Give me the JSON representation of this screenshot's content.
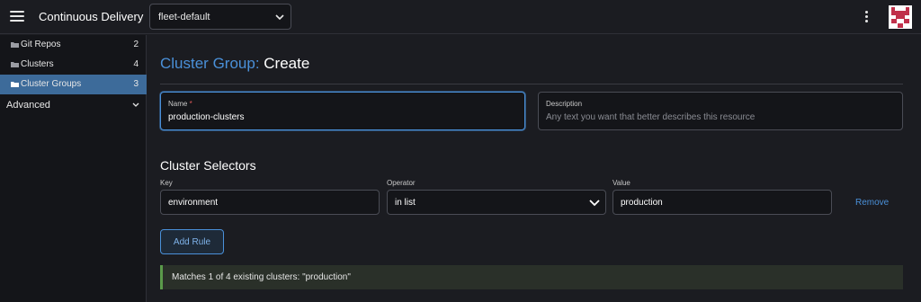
{
  "header": {
    "app_title": "Continuous Delivery",
    "workspace_value": "fleet-default",
    "menu_icon": "hamburger-menu-icon",
    "more_icon": "more-vertical-icon",
    "avatar_icon": "user-avatar"
  },
  "sidebar": {
    "items": [
      {
        "label": "Git Repos",
        "count": "2",
        "icon": "folder-icon",
        "active": false
      },
      {
        "label": "Clusters",
        "count": "4",
        "icon": "folder-icon",
        "active": false
      },
      {
        "label": "Cluster Groups",
        "count": "3",
        "icon": "folder-open-icon",
        "active": true
      }
    ],
    "advanced": {
      "label": "Advanced",
      "icon": "chevron-down-icon"
    }
  },
  "main": {
    "title_prefix": "Cluster Group:",
    "title_action": "Create",
    "name_field": {
      "label": "Name",
      "required_mark": "*",
      "value": "production-clusters"
    },
    "description_field": {
      "label": "Description",
      "placeholder": "Any text you want that better describes this resource"
    },
    "selectors": {
      "title": "Cluster Selectors",
      "key_label": "Key",
      "operator_label": "Operator",
      "value_label": "Value",
      "rows": [
        {
          "key": "environment",
          "operator": "in list",
          "value": "production",
          "remove_label": "Remove"
        }
      ]
    },
    "add_rule_label": "Add Rule",
    "match_banner": "Matches 1 of 4 existing clusters: \"production\""
  },
  "colors": {
    "accent": "#4a90d9",
    "active_nav": "#3d6b9a",
    "success_border": "#5a9a4a",
    "background": "#1b1c21"
  }
}
